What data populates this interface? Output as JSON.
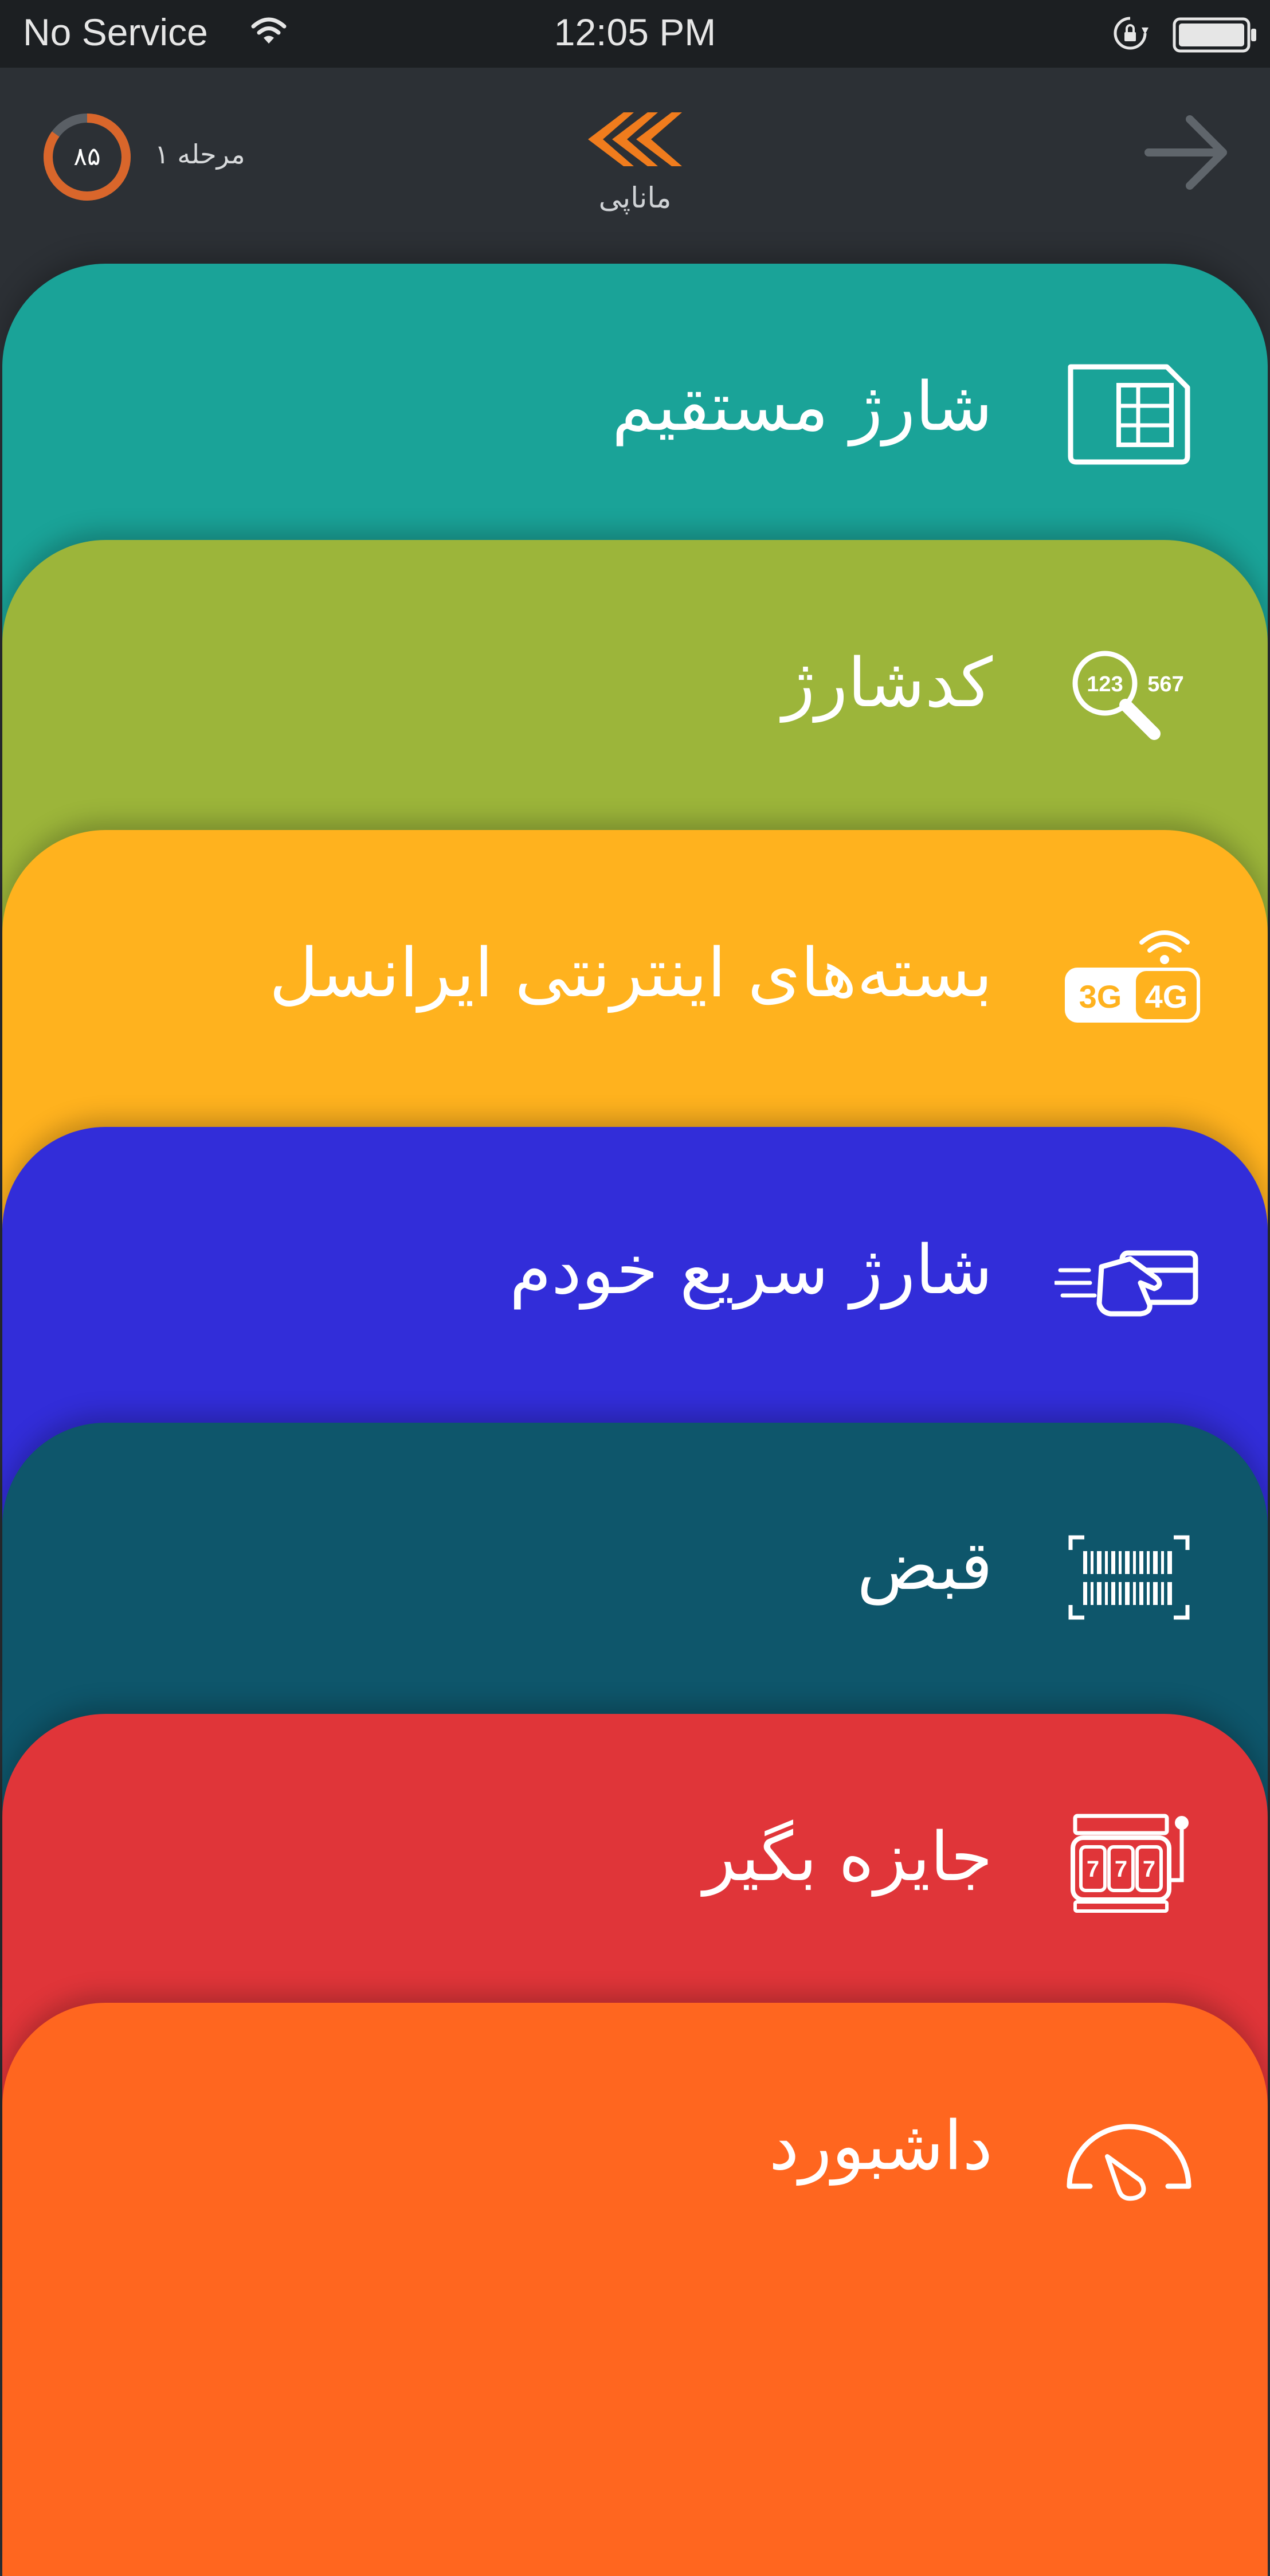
{
  "status_bar": {
    "carrier": "No Service",
    "time": "12:05 PM"
  },
  "header": {
    "level_value": "۸۵",
    "level_progress_percent": 85,
    "level_label": "مرحله ۱",
    "app_name": "ماناپی"
  },
  "cards": [
    {
      "label": "شارژ مستقیم",
      "icon": "sim-card-icon",
      "color": "#1aa398"
    },
    {
      "label": "کدشارژ",
      "icon": "charge-code-search-icon",
      "color": "#9cb53a"
    },
    {
      "label": "بسته‌های اینترنتی ایرانسل",
      "icon": "3g-4g-internet-icon",
      "color": "#ffb21e"
    },
    {
      "label": "شارژ سریع خودم",
      "icon": "fast-card-payment-icon",
      "color": "#322dd9"
    },
    {
      "label": "قبض",
      "icon": "barcode-scan-icon",
      "color": "#0e566b"
    },
    {
      "label": "جایزه بگیر",
      "icon": "slot-machine-icon",
      "color": "#e03539"
    },
    {
      "label": "داشبورد",
      "icon": "dashboard-gauge-icon",
      "color": "#ff661f"
    }
  ],
  "colors": {
    "status_bar_bg": "#1c1f22",
    "header_bg": "#2c3035",
    "logo_orange": "#f07c1d",
    "ring_orange": "#d9662b"
  }
}
